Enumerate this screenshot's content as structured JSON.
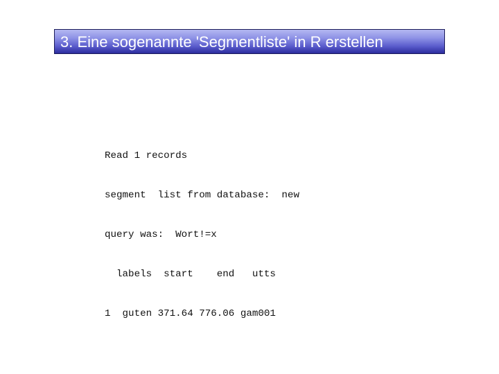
{
  "slide": {
    "title": "3. Eine sogenannte 'Segmentliste' in R erstellen"
  },
  "console": {
    "lines": [
      "Read 1 records",
      "segment  list from database:  new",
      "query was:  Wort!=x",
      "  labels  start    end   utts",
      "1  guten 371.64 776.06 gam001"
    ],
    "table": {
      "columns": [
        "labels",
        "start",
        "end",
        "utts"
      ],
      "rows": [
        {
          "index": "1",
          "labels": "guten",
          "start": "371.64",
          "end": "776.06",
          "utts": "gam001"
        }
      ]
    }
  },
  "colors": {
    "title_gradient_top": "#b4b8f2",
    "title_gradient_bottom": "#2c2c9e",
    "title_text": "#ffffff"
  }
}
